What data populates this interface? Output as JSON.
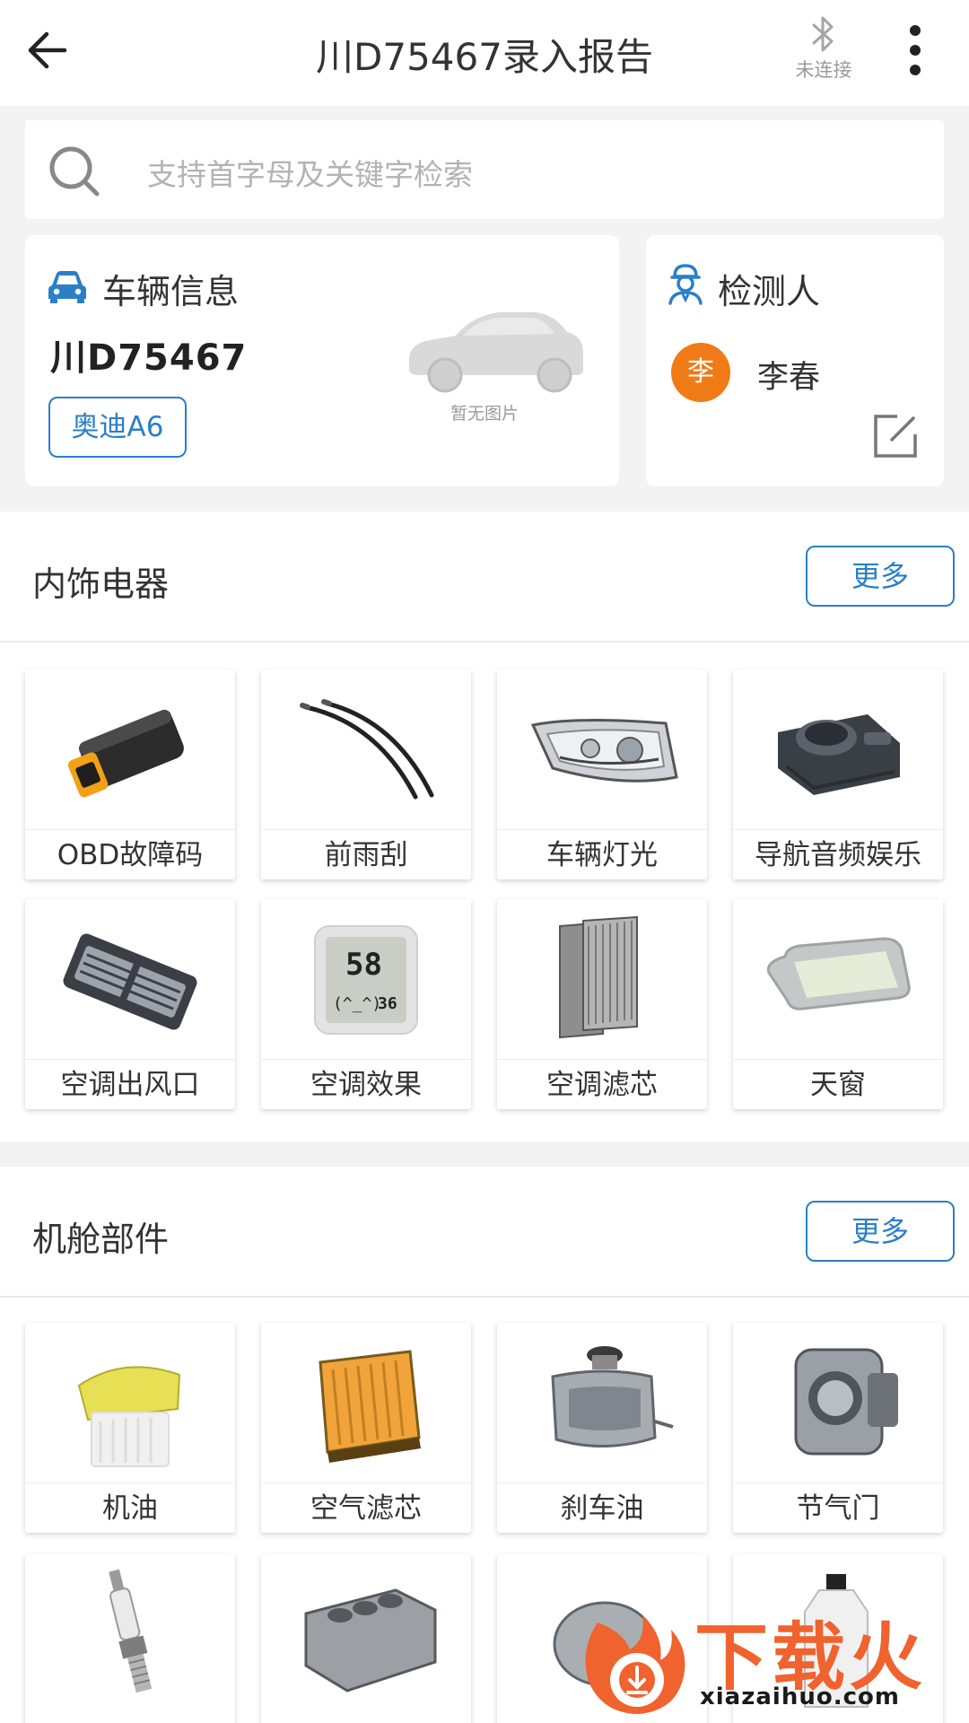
{
  "header": {
    "title": "川D75467录入报告",
    "bluetooth_status": "未连接"
  },
  "search": {
    "placeholder": "支持首字母及关键字检索"
  },
  "vehicle_card": {
    "title": "车辆信息",
    "plate": "川D75467",
    "model": "奥迪A6",
    "no_image_text": "暂无图片"
  },
  "inspector_card": {
    "title": "检测人",
    "avatar_initial": "李",
    "name": "李春"
  },
  "sections": [
    {
      "title": "内饰电器",
      "more_label": "更多",
      "items": [
        {
          "label": "OBD故障码",
          "icon": "obd-connector-icon"
        },
        {
          "label": "前雨刮",
          "icon": "wiper-icon"
        },
        {
          "label": "车辆灯光",
          "icon": "headlight-icon"
        },
        {
          "label": "导航音频娱乐",
          "icon": "nav-controller-icon"
        },
        {
          "label": "空调出风口",
          "icon": "ac-vent-icon"
        },
        {
          "label": "空调效果",
          "icon": "thermometer-display-icon",
          "display": {
            "temp": "58",
            "humidity": "36",
            "face": "(^_^)"
          }
        },
        {
          "label": "空调滤芯",
          "icon": "cabin-filter-icon"
        },
        {
          "label": "天窗",
          "icon": "sunroof-icon"
        }
      ]
    },
    {
      "title": "机舱部件",
      "more_label": "更多",
      "items": [
        {
          "label": "机油",
          "icon": "engine-oil-icon"
        },
        {
          "label": "空气滤芯",
          "icon": "air-filter-icon"
        },
        {
          "label": "刹车油",
          "icon": "brake-fluid-icon"
        },
        {
          "label": "节气门",
          "icon": "throttle-icon"
        },
        {
          "label": "",
          "icon": "spark-plug-icon"
        },
        {
          "label": "",
          "icon": "engine-block-icon"
        },
        {
          "label": "",
          "icon": "part-icon"
        },
        {
          "label": "",
          "icon": "bottle-icon"
        }
      ]
    }
  ],
  "watermark": {
    "text": "下载火",
    "url": "xiazaihuo.com"
  },
  "colors": {
    "accent": "#2a7fc7",
    "avatar": "#f07b16",
    "watermark": "#f0622e"
  }
}
